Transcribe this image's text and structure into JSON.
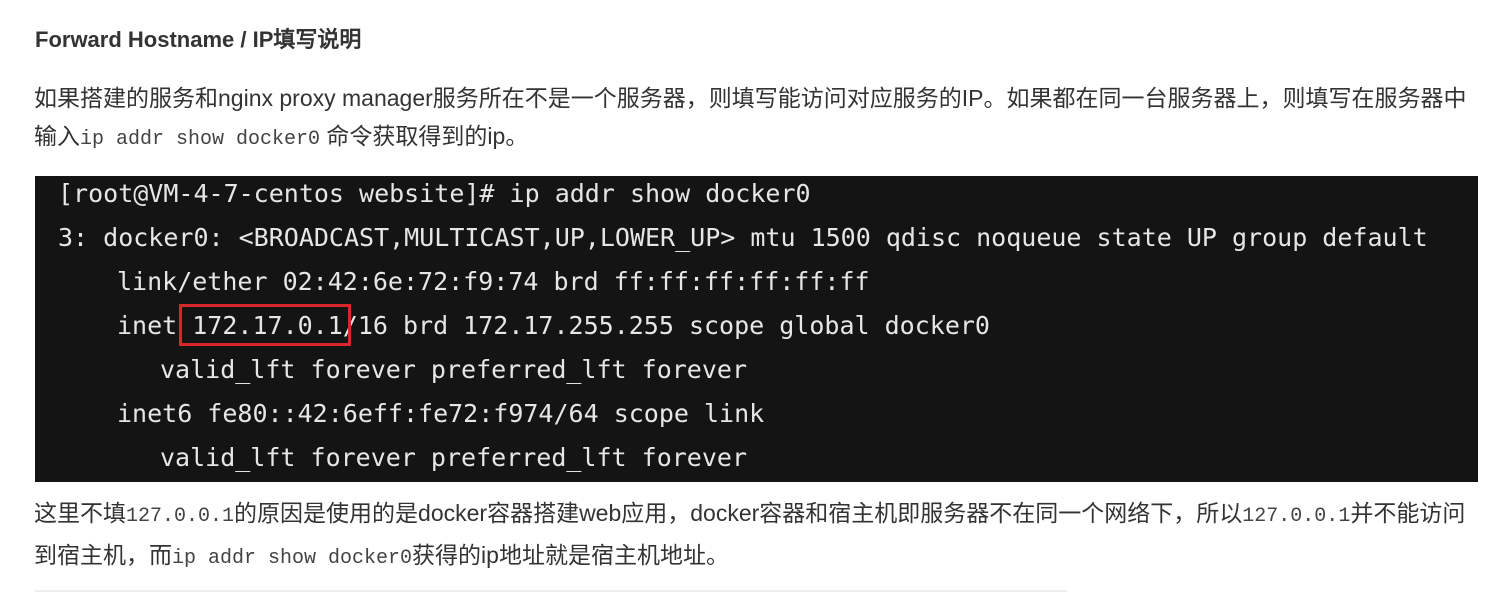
{
  "heading": "Forward Hostname / IP填写说明",
  "paragraph1": {
    "text_before": "如果搭建的服务和nginx proxy manager服务所在不是一个服务器，则填写能访问对应服务的IP。如果都在同一台服务器上，则填写在服务器中输入",
    "code": "ip addr show docker0",
    "text_after": " 命令获取得到的ip。"
  },
  "terminal": {
    "lines": [
      "[root@VM-4-7-centos website]# ip addr show docker0",
      "3: docker0: <BROADCAST,MULTICAST,UP,LOWER_UP> mtu 1500 qdisc noqueue state UP group default",
      "link/ether 02:42:6e:72:f9:74 brd ff:ff:ff:ff:ff:ff",
      "inet 172.17.0.1/16 brd 172.17.255.255 scope global docker0",
      "valid_lft forever preferred_lft forever",
      "inet6 fe80::42:6eff:fe72:f974/64 scope link",
      "valid_lft forever preferred_lft forever"
    ],
    "highlighted_value": "172.17.0.1",
    "highlight_color": "#d9262a",
    "background_color": "#141414"
  },
  "paragraph2": {
    "text1": "这里不填",
    "code1": "127.0.0.1",
    "text2": "的原因是使用的是docker容器搭建web应用，docker容器和宿主机即服务器不在同一个网络下，所以",
    "code2": "127.0.0.1",
    "text3": "并不能访问到宿主机，而",
    "code3": "ip addr show docker0",
    "text4": "获得的ip地址就是宿主机地址。"
  }
}
